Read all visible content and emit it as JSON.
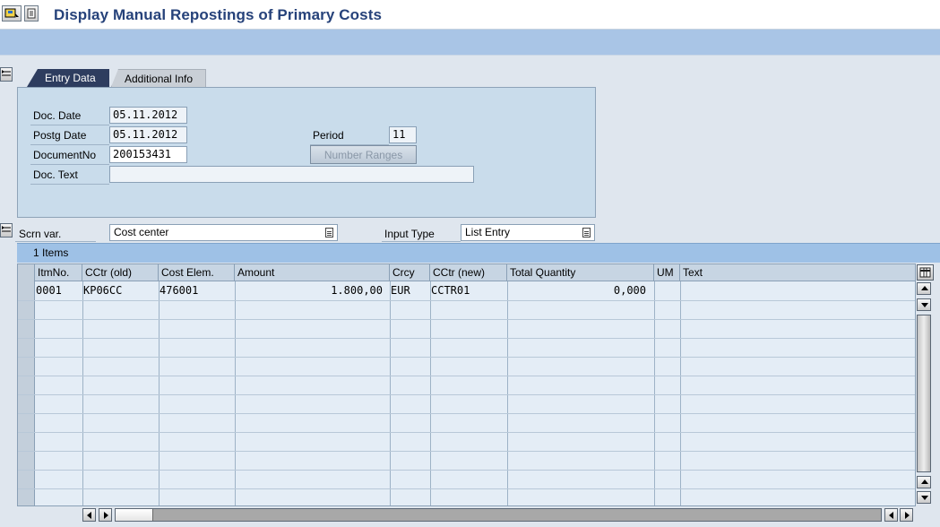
{
  "window": {
    "title": "Display Manual Repostings of Primary Costs"
  },
  "tabs": [
    {
      "label": "Entry Data",
      "active": true
    },
    {
      "label": "Additional Info",
      "active": false
    }
  ],
  "entry": {
    "doc_date_label": "Doc. Date",
    "doc_date_value": "05.11.2012",
    "postg_date_label": "Postg Date",
    "postg_date_value": "05.11.2012",
    "document_no_label": "DocumentNo",
    "document_no_value": "200153431",
    "doc_text_label": "Doc. Text",
    "doc_text_value": "",
    "period_label": "Period",
    "period_value": "11",
    "number_ranges_label": "Number Ranges"
  },
  "selection": {
    "scrn_var_label": "Scrn var.",
    "scrn_var_value": "Cost center",
    "input_type_label": "Input Type",
    "input_type_value": "List Entry"
  },
  "table": {
    "title": "1 Items",
    "columns": [
      "ItmNo.",
      "CCtr (old)",
      "Cost Elem.",
      "Amount",
      "Crcy",
      "CCtr (new)",
      "Total Quantity",
      "UM",
      "Text"
    ],
    "rows": [
      {
        "itmno": "0001",
        "cctr_old": "KP06CC",
        "cost_elem": "476001",
        "amount": "1.800,00",
        "crcy": "EUR",
        "cctr_new": "CCTR01",
        "total_quantity": "0,000",
        "um": "",
        "text": ""
      }
    ]
  },
  "colors": {
    "title_text": "#26427a",
    "app_bar": "#a9c5e6",
    "tab_active": "#2e3d5f",
    "panel_bg": "#c9dceb",
    "table_title_bg": "#9ec1e6"
  },
  "icons": [
    "menu-icon",
    "layout-icon",
    "collapse-icon",
    "dropdown-list-icon",
    "table-settings-icon",
    "arrow-up-icon",
    "arrow-down-icon",
    "arrow-left-icon",
    "arrow-right-icon"
  ]
}
